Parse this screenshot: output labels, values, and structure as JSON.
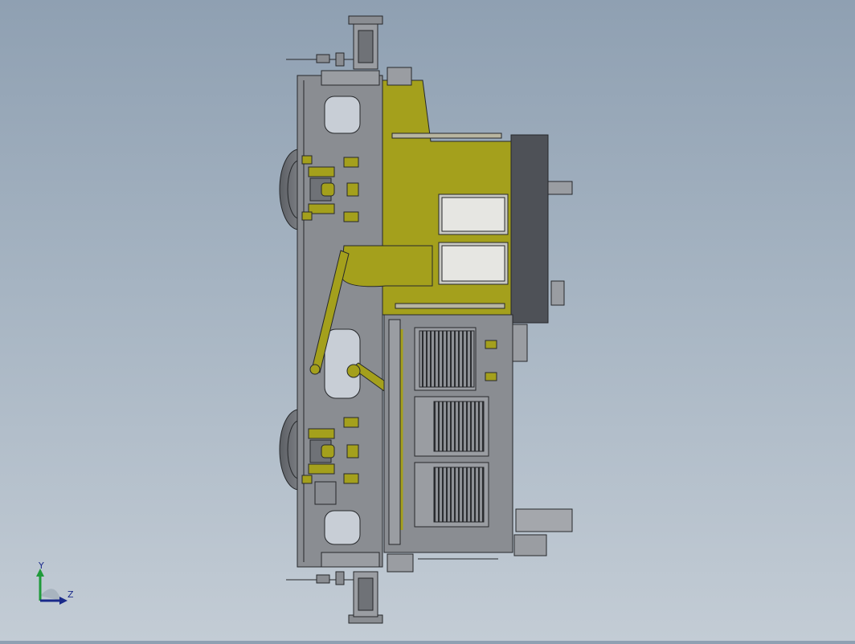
{
  "triad": {
    "x_label": "",
    "y_label": "Y",
    "z_label": "Z"
  },
  "colors": {
    "background_top": "#8fa0b2",
    "background_bottom": "#c3ccd5",
    "body_grey": "#8a8d92",
    "body_grey_light": "#a4a7ac",
    "yellow_green": "#a4a01c",
    "dark_panel": "#4e5157",
    "outline": "#26282b"
  },
  "icons": [
    "coordinate-triad-icon"
  ]
}
